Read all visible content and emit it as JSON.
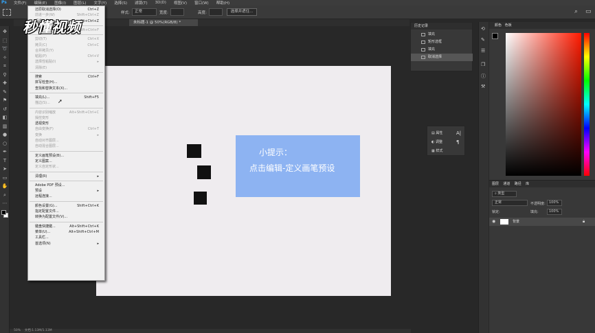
{
  "app_icon": "Ps",
  "menubar": [
    "文件(F)",
    "编辑(E)",
    "图像(I)",
    "图层(L)",
    "文字(Y)",
    "选择(S)",
    "滤镜(T)",
    "3D(D)",
    "视图(V)",
    "窗口(W)",
    "帮助(H)"
  ],
  "options_bar": {
    "style_label": "样式:",
    "style_value": "正常",
    "width_label": "宽度:",
    "height_label": "高度:",
    "select_mask_button": "选择并遮住..."
  },
  "document_tab": "未标题-1 @ 50%(RGB/8) *",
  "watermark": "秒懂视频",
  "edit_menu": [
    {
      "label": "还原取消选择(O)",
      "shortcut": "Ctrl+Z",
      "disabled": false
    },
    {
      "label": "前进一步(W)",
      "shortcut": "Shift+Ctrl+Z",
      "disabled": true
    },
    {
      "label": "后退一步(K)",
      "shortcut": "Alt+Ctrl+Z",
      "disabled": false
    },
    {
      "sep": true
    },
    {
      "label": "渐隐(D)...",
      "shortcut": "Shift+Ctrl+F",
      "disabled": true
    },
    {
      "sep": true
    },
    {
      "label": "剪切(T)",
      "shortcut": "Ctrl+X",
      "disabled": true
    },
    {
      "label": "拷贝(C)",
      "shortcut": "Ctrl+C",
      "disabled": true
    },
    {
      "label": "合并拷贝(Y)",
      "shortcut": "",
      "disabled": true
    },
    {
      "label": "粘贴(P)",
      "shortcut": "Ctrl+V",
      "disabled": true
    },
    {
      "label": "选择性粘贴(I)",
      "shortcut": "▸",
      "disabled": true
    },
    {
      "label": "清除(E)",
      "shortcut": "",
      "disabled": true
    },
    {
      "sep": true
    },
    {
      "label": "搜索",
      "shortcut": "Ctrl+F",
      "disabled": false
    },
    {
      "label": "拼写检查(H)...",
      "shortcut": "",
      "disabled": false
    },
    {
      "label": "查找和替换文本(X)...",
      "shortcut": "",
      "disabled": false
    },
    {
      "sep": true
    },
    {
      "label": "填充(L)...",
      "shortcut": "Shift+F5",
      "disabled": false
    },
    {
      "label": "描边(S)...",
      "shortcut": "",
      "disabled": true
    },
    {
      "sep": true
    },
    {
      "label": "内容识别缩放",
      "shortcut": "Alt+Shift+Ctrl+C",
      "disabled": true
    },
    {
      "label": "操控变形",
      "shortcut": "",
      "disabled": true
    },
    {
      "label": "透视变形",
      "shortcut": "",
      "disabled": false
    },
    {
      "label": "自由变换(F)",
      "shortcut": "Ctrl+T",
      "disabled": true
    },
    {
      "label": "变换",
      "shortcut": "▸",
      "disabled": true
    },
    {
      "label": "自动对齐图层...",
      "shortcut": "",
      "disabled": true
    },
    {
      "label": "自动混合图层...",
      "shortcut": "",
      "disabled": true
    },
    {
      "sep": true
    },
    {
      "label": "定义画笔预设(B)...",
      "shortcut": "",
      "disabled": false
    },
    {
      "label": "定义图案...",
      "shortcut": "",
      "disabled": false
    },
    {
      "label": "定义自定形状...",
      "shortcut": "",
      "disabled": true
    },
    {
      "sep": true
    },
    {
      "label": "清理(R)",
      "shortcut": "▸",
      "disabled": false
    },
    {
      "sep": true
    },
    {
      "label": "Adobe PDF 预设...",
      "shortcut": "",
      "disabled": false
    },
    {
      "label": "预设",
      "shortcut": "▸",
      "disabled": false
    },
    {
      "label": "远程连接...",
      "shortcut": "",
      "disabled": false
    },
    {
      "sep": true
    },
    {
      "label": "颜色设置(G)...",
      "shortcut": "Shift+Ctrl+K",
      "disabled": false
    },
    {
      "label": "指定配置文件...",
      "shortcut": "",
      "disabled": false
    },
    {
      "label": "转换为配置文件(V)...",
      "shortcut": "",
      "disabled": false
    },
    {
      "sep": true
    },
    {
      "label": "键盘快捷键...",
      "shortcut": "Alt+Shift+Ctrl+K",
      "disabled": false
    },
    {
      "label": "菜单(U)...",
      "shortcut": "Alt+Shift+Ctrl+M",
      "disabled": false
    },
    {
      "label": "工具栏...",
      "shortcut": "",
      "disabled": false
    },
    {
      "label": "首选项(N)",
      "shortcut": "▸",
      "disabled": false
    }
  ],
  "tip": {
    "title": "小提示：",
    "body": "点击编辑-定义画笔预设"
  },
  "history": {
    "title": "历史记录",
    "items": [
      "填充",
      "矩形选框",
      "填充",
      "取消选择"
    ]
  },
  "properties": {
    "items": [
      "属性",
      "调整",
      "样式"
    ]
  },
  "color_panel": {
    "tabs": [
      "颜色",
      "色板"
    ]
  },
  "layers_panel": {
    "tabs": [
      "图层",
      "通道",
      "路径",
      "库"
    ],
    "kind_label": "类型",
    "blend_mode": "正常",
    "opacity_label": "不透明度:",
    "opacity_value": "100%",
    "lock_label": "锁定:",
    "fill_label": "填充:",
    "fill_value": "100%",
    "layer_name": "背景"
  },
  "status": {
    "zoom": "50%",
    "doc_info": "文档:1.13M/1.13M"
  }
}
